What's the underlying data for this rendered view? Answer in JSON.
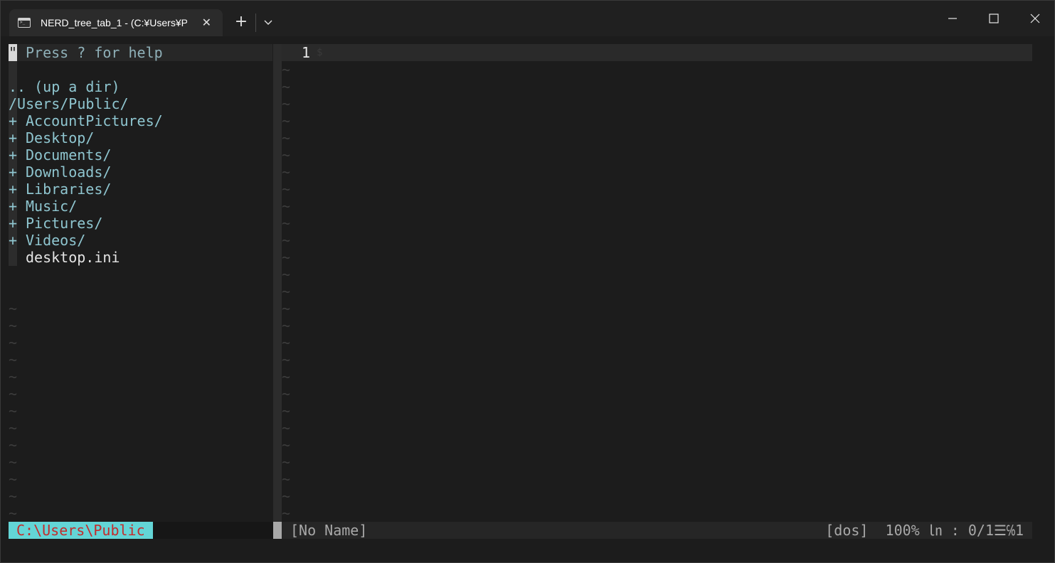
{
  "tab": {
    "title": "NERD_tree_tab_1 - (C:¥Users¥P",
    "icon": "terminal-icon",
    "close_icon": "close-icon"
  },
  "titlebar": {
    "new_tab_icon": "plus-icon",
    "dropdown_icon": "chevron-down-icon",
    "minimize_icon": "minimize-icon",
    "maximize_icon": "maximize-icon",
    "close_icon": "close-icon"
  },
  "nerdtree": {
    "help_marker": "\"",
    "help": "Press ? for help",
    "up_dir": ".. (up a dir)",
    "root": "/Users/Public/",
    "entries": [
      {
        "prefix": "+",
        "name": "AccountPictures/",
        "type": "dir"
      },
      {
        "prefix": "+",
        "name": "Desktop/",
        "type": "dir"
      },
      {
        "prefix": "+",
        "name": "Documents/",
        "type": "dir"
      },
      {
        "prefix": "+",
        "name": "Downloads/",
        "type": "dir"
      },
      {
        "prefix": "+",
        "name": "Libraries/",
        "type": "dir"
      },
      {
        "prefix": "+",
        "name": "Music/",
        "type": "dir"
      },
      {
        "prefix": "+",
        "name": "Pictures/",
        "type": "dir"
      },
      {
        "prefix": "+",
        "name": "Videos/",
        "type": "dir"
      },
      {
        "prefix": "",
        "name": "desktop.ini",
        "type": "file"
      }
    ],
    "empty_line_marker": "~",
    "statusline": "C:\\Users\\Public"
  },
  "editor": {
    "line_number": "1",
    "eol_marker": "$",
    "empty_line_marker": "~",
    "statusline": {
      "name": "[No Name]",
      "info": "[dos]  100% ㏑ : 0/1☰℅1"
    }
  },
  "colors": {
    "background": "#1c1c1c",
    "nerdtree_dir": "#8fc6d0",
    "nerdtree_file": "#e4e4e4",
    "statusline_accent": "#63d5d6",
    "statusline_text": "#c42b2b"
  }
}
